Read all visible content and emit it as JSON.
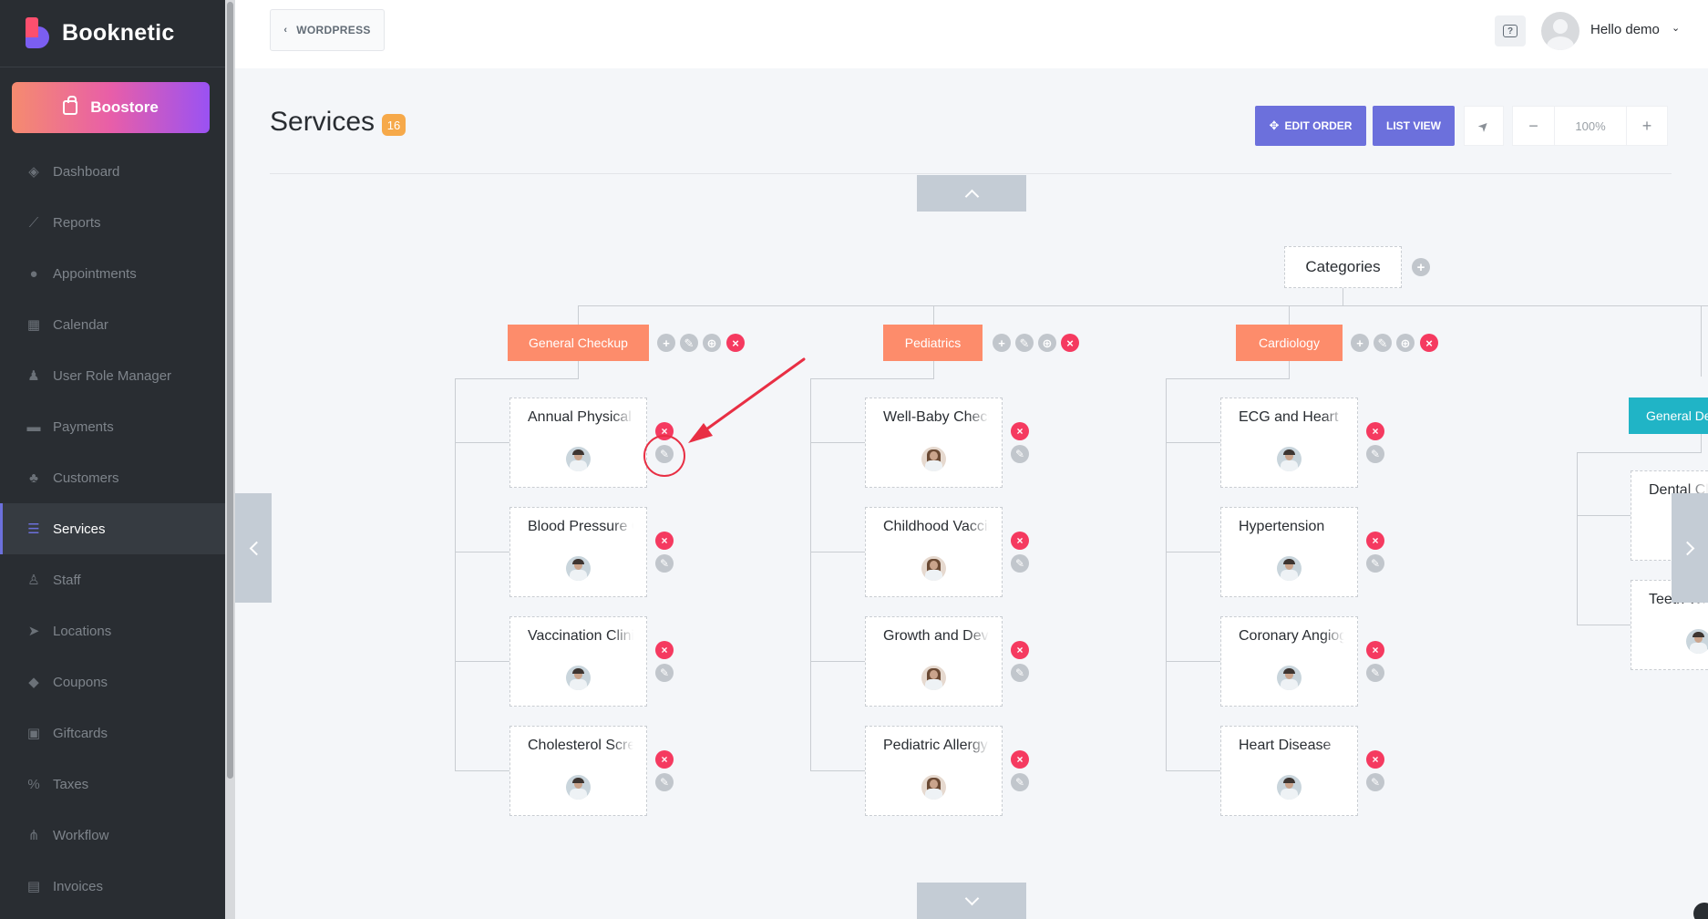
{
  "app": {
    "name": "Booknetic"
  },
  "sidebar": {
    "boostore_label": "Boostore",
    "items": [
      {
        "label": "Dashboard",
        "icon": "dashboard-icon",
        "active": false
      },
      {
        "label": "Reports",
        "icon": "chart-icon",
        "active": false
      },
      {
        "label": "Appointments",
        "icon": "clock-icon",
        "active": false
      },
      {
        "label": "Calendar",
        "icon": "calendar-icon",
        "active": false
      },
      {
        "label": "User Role Manager",
        "icon": "user-plus-icon",
        "active": false
      },
      {
        "label": "Payments",
        "icon": "card-icon",
        "active": false
      },
      {
        "label": "Customers",
        "icon": "users-icon",
        "active": false
      },
      {
        "label": "Services",
        "icon": "list-icon",
        "active": true
      },
      {
        "label": "Staff",
        "icon": "user-icon",
        "active": false
      },
      {
        "label": "Locations",
        "icon": "location-arrow-icon",
        "active": false
      },
      {
        "label": "Coupons",
        "icon": "tag-icon",
        "active": false
      },
      {
        "label": "Giftcards",
        "icon": "gift-icon",
        "active": false
      },
      {
        "label": "Taxes",
        "icon": "percent-icon",
        "active": false
      },
      {
        "label": "Workflow",
        "icon": "workflow-icon",
        "active": false
      },
      {
        "label": "Invoices",
        "icon": "invoice-icon",
        "active": false
      }
    ]
  },
  "topbar": {
    "back_label": "WORDPRESS",
    "greeting": "Hello demo"
  },
  "page": {
    "title": "Services",
    "count": "16"
  },
  "toolbar": {
    "edit_order": "EDIT ORDER",
    "list_view": "LIST VIEW",
    "minus": "−",
    "zoom": "100%",
    "plus": "+"
  },
  "tree": {
    "root": "Categories",
    "categories": [
      {
        "name": "General Checkup",
        "services": [
          "Annual Physical Exam",
          "Blood Pressure Check",
          "Vaccination Clinic",
          "Cholesterol Screening"
        ]
      },
      {
        "name": "Pediatrics",
        "services": [
          "Well-Baby Checkup",
          "Childhood Vaccinations",
          "Growth and Development",
          "Pediatric Allergy"
        ]
      },
      {
        "name": "Cardiology",
        "services": [
          "ECG and Heart",
          "Hypertension",
          "Coronary Angiography",
          "Heart Disease"
        ]
      },
      {
        "name": "General Dentistry",
        "services": [
          "Dental Checkup",
          "Teeth Whitening"
        ]
      }
    ]
  },
  "colors": {
    "accent": "#6c70dc",
    "category": "#fd8c6b",
    "category_alt": "#20b4c6",
    "delete": "#f53a60",
    "annotation": "#e82f44"
  }
}
